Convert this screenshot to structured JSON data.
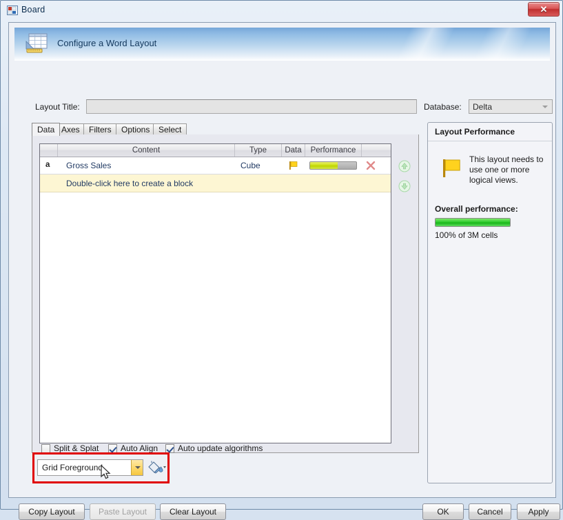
{
  "window": {
    "title": "Board",
    "title_icon": "app-window-icon",
    "close_label": "✕"
  },
  "banner": {
    "icon": "layout-grid-ruler-icon",
    "title": "Configure a Word Layout"
  },
  "form": {
    "layout_title_label": "Layout Title:",
    "layout_title_value": "",
    "layout_title_placeholder": "",
    "database_label": "Database:",
    "database_value": "Delta"
  },
  "tabs": [
    {
      "label": "Data",
      "active": true
    },
    {
      "label": "Axes",
      "active": false
    },
    {
      "label": "Filters",
      "active": false
    },
    {
      "label": "Options",
      "active": false
    },
    {
      "label": "Select",
      "active": false
    }
  ],
  "grid": {
    "columns": [
      "",
      "Content",
      "Type",
      "Data",
      "Performance",
      ""
    ],
    "rows": [
      {
        "marker": "a",
        "content": "Gross Sales",
        "type": "Cube",
        "data_icon": "yellow-flag-icon",
        "performance_percent": 60,
        "delete_icon": "delete-x-icon"
      }
    ],
    "placeholder_row": "Double-click here to create a block",
    "move_up_icon": "arrow-up-circle-icon",
    "move_down_icon": "arrow-down-circle-icon"
  },
  "checkboxes": [
    {
      "label": "Split & Splat",
      "checked": false
    },
    {
      "label": "Auto Align",
      "checked": true
    },
    {
      "label": "Auto update algorithms",
      "checked": true
    }
  ],
  "color_selector": {
    "value": "Grid Foreground",
    "dropdown_icon": "chevron-down-icon",
    "fill_icon": "paint-bucket-icon",
    "fill_dropdown_icon": "chevron-down-icon",
    "highlight_color": "#e00000",
    "dropdown_button_color": "#f5c63f"
  },
  "performance_panel": {
    "title": "Layout Performance",
    "icon": "yellow-flag-icon",
    "message": "This layout needs to use one or more logical views.",
    "overall_label": "Overall performance:",
    "overall_percent": 100,
    "overall_caption": "100% of 3M cells",
    "bar_color": "#22bb22"
  },
  "buttons": {
    "copy_layout": "Copy Layout",
    "paste_layout": "Paste Layout",
    "clear_layout": "Clear Layout",
    "ok": "OK",
    "cancel": "Cancel",
    "apply": "Apply"
  }
}
